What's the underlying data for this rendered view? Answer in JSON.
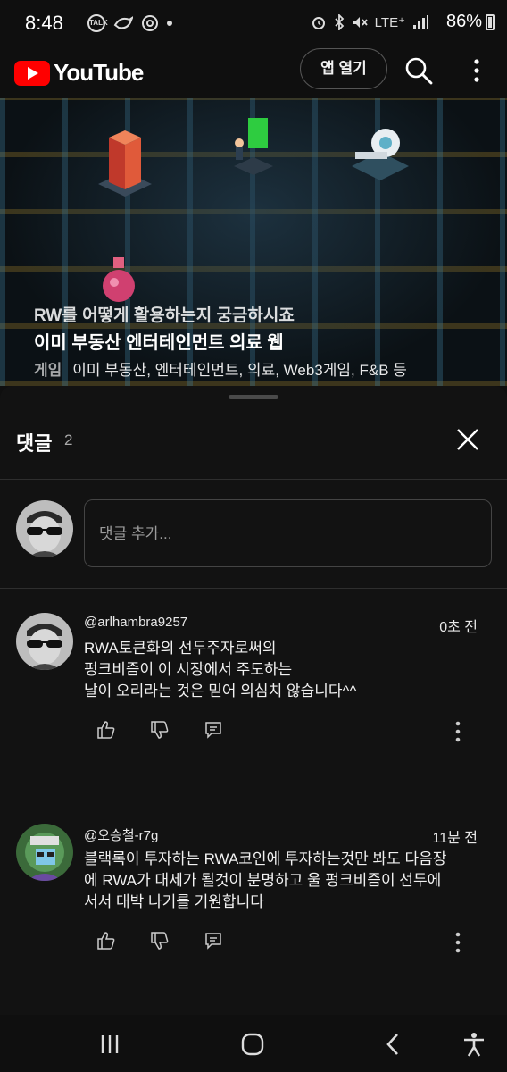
{
  "status_bar": {
    "time": "8:48",
    "left_icons": [
      "talk-icon",
      "bird-app-icon",
      "chrome-icon",
      "dot-icon"
    ],
    "right_icons": [
      "alarm-icon",
      "bluetooth-icon",
      "mute-icon",
      "lte-icon",
      "signal-icon"
    ],
    "network": "LTE⁺",
    "battery": "86%"
  },
  "top_bar": {
    "brand": "YouTube",
    "open_app_label": "앱 열기",
    "icons": [
      "search-icon",
      "more-vertical-icon"
    ]
  },
  "video": {
    "overlay_line1": "RW를 어떻게 활용하는지 궁금하시죠",
    "overlay_line2": "이미 부동산 엔터테인먼트 의료 웹",
    "overlay_line3_prefix": "게임",
    "overlay_line3": "이미 부동산, 엔터테인먼트, 의료, Web3게임, F&B 등"
  },
  "comments_sheet": {
    "title": "댓글",
    "count": "2",
    "add_comment_placeholder": "댓글 추가...",
    "comments": [
      {
        "author": "@arlhambra9257",
        "time": "0초 전",
        "lines": [
          "RWA토큰화의 선두주자로써의",
          "펑크비즘이 이 시장에서 주도하는",
          "날이 오리라는 것은 믿어 의심치 않습니다^^"
        ]
      },
      {
        "author": "@오승철-r7g",
        "time": "11분 전",
        "lines": [
          "블랙록이 투자하는 RWA코인에 투자하는것만 봐도 다음장",
          "에 RWA가 대세가 될것이 분명하고 울 펑크비즘이 선두에",
          "서서 대박 나기를 기원합니다"
        ]
      }
    ]
  },
  "nav_bar": {
    "icons": [
      "recent-apps-icon",
      "home-icon",
      "back-icon",
      "accessibility-icon"
    ]
  }
}
